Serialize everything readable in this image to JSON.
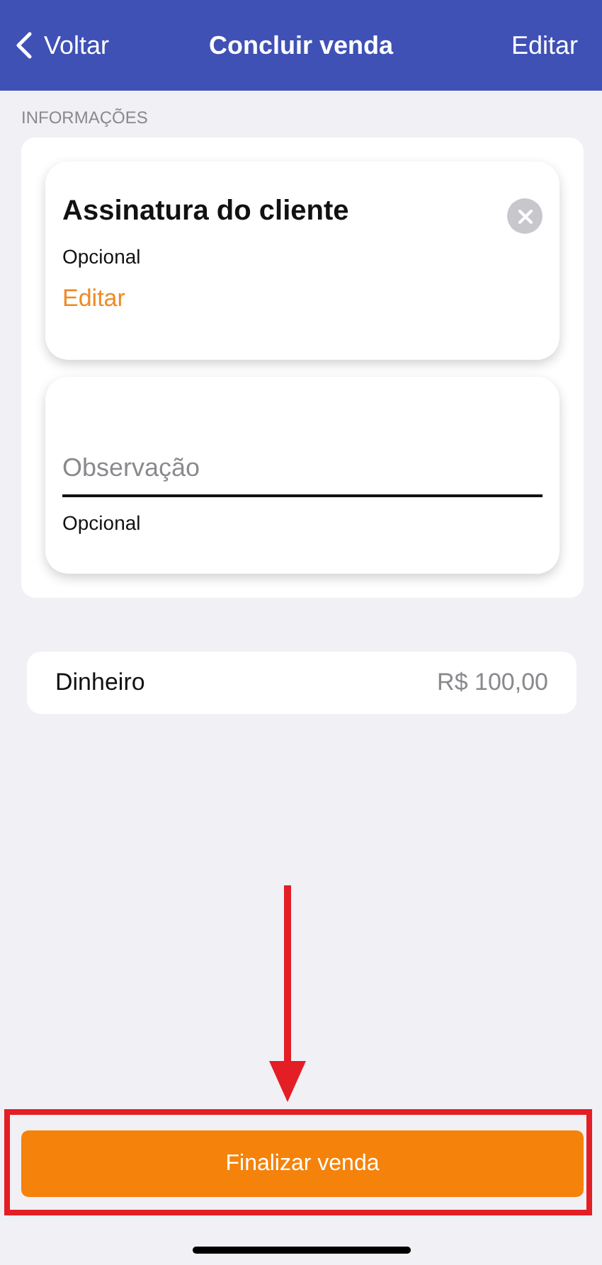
{
  "nav": {
    "back": "Voltar",
    "title": "Concluir venda",
    "action": "Editar"
  },
  "section_label": "INFORMAÇÕES",
  "signature": {
    "title": "Assinatura do cliente",
    "hint": "Opcional",
    "edit": "Editar"
  },
  "observation": {
    "placeholder": "Observação",
    "hint": "Opcional"
  },
  "payment": {
    "method": "Dinheiro",
    "amount": "R$ 100,00"
  },
  "finish_button": "Finalizar venda"
}
